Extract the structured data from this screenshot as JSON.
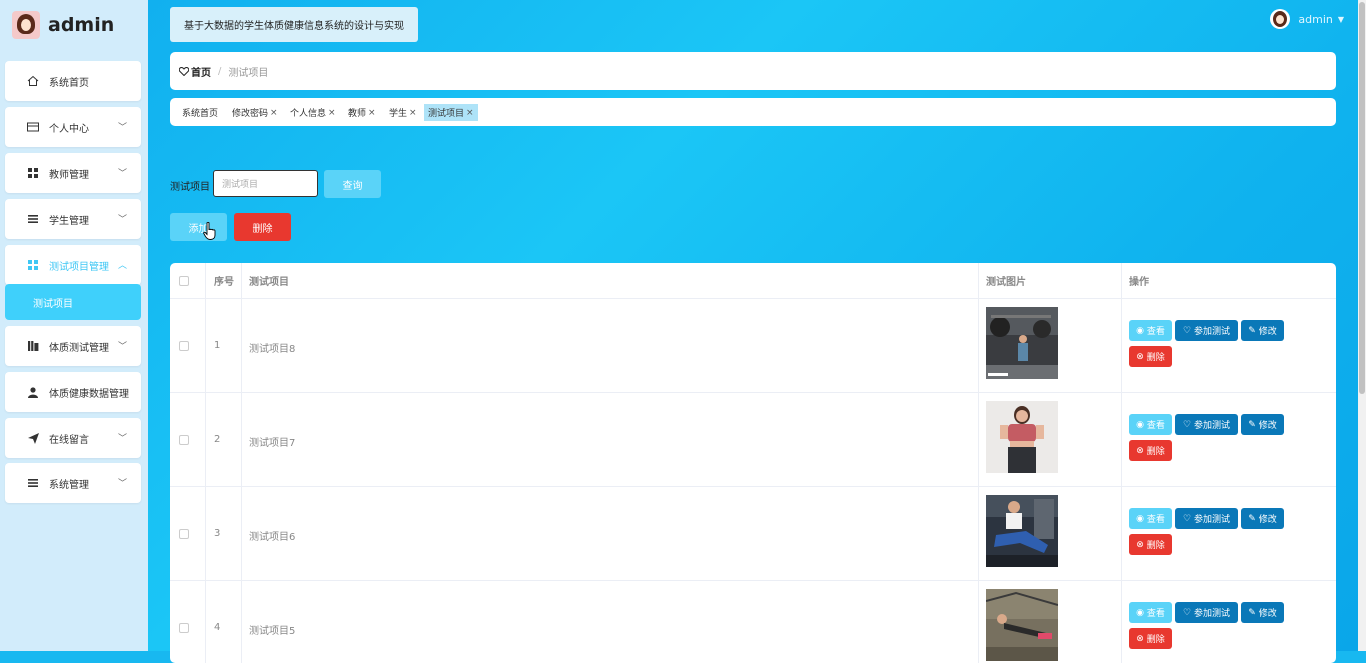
{
  "app": {
    "logo_text": "admin",
    "title": "基于大数据的学生体质健康信息系统的设计与实现",
    "user": "admin"
  },
  "sidebar": {
    "items": [
      {
        "label": "系统首页",
        "icon": "home-icon",
        "chev": false
      },
      {
        "label": "个人中心",
        "icon": "card-icon",
        "chev": true
      },
      {
        "label": "教师管理",
        "icon": "grid-icon",
        "chev": true
      },
      {
        "label": "学生管理",
        "icon": "list-icon",
        "chev": true
      },
      {
        "label": "测试项目管理",
        "icon": "grid-icon",
        "chev": true,
        "active": true
      },
      {
        "label": "体质测试管理",
        "icon": "bars-icon",
        "chev": true
      },
      {
        "label": "体质健康数据管理",
        "icon": "person-icon",
        "chev": false
      },
      {
        "label": "在线留言",
        "icon": "send-icon",
        "chev": true
      },
      {
        "label": "系统管理",
        "icon": "menu-icon",
        "chev": true
      }
    ],
    "sub_item": "测试项目"
  },
  "breadcrumb": {
    "home": "首页",
    "sep": "/",
    "current": "测试项目"
  },
  "tags": [
    {
      "label": "系统首页",
      "closable": false
    },
    {
      "label": "修改密码",
      "closable": true
    },
    {
      "label": "个人信息",
      "closable": true
    },
    {
      "label": "教师",
      "closable": true
    },
    {
      "label": "学生",
      "closable": true
    },
    {
      "label": "测试项目",
      "closable": true,
      "active": true
    }
  ],
  "search": {
    "label": "测试项目",
    "placeholder": "测试项目",
    "query_label": "查询"
  },
  "toolbar": {
    "add_label": "添加",
    "delete_label": "删除"
  },
  "table": {
    "headers": {
      "index": "序号",
      "name": "测试项目",
      "image": "测试图片",
      "actions": "操作"
    },
    "rows": [
      {
        "index": "1",
        "name": "测试项目8"
      },
      {
        "index": "2",
        "name": "测试项目7"
      },
      {
        "index": "3",
        "name": "测试项目6"
      },
      {
        "index": "4",
        "name": "测试项目5"
      }
    ],
    "actions": {
      "view": "查看",
      "join": "参加测试",
      "edit": "修改",
      "delete": "删除"
    }
  },
  "colors": {
    "primary": "#5ad3f8",
    "dark": "#0a78b8",
    "danger": "#e8382f",
    "bg": "#18b8f0"
  }
}
